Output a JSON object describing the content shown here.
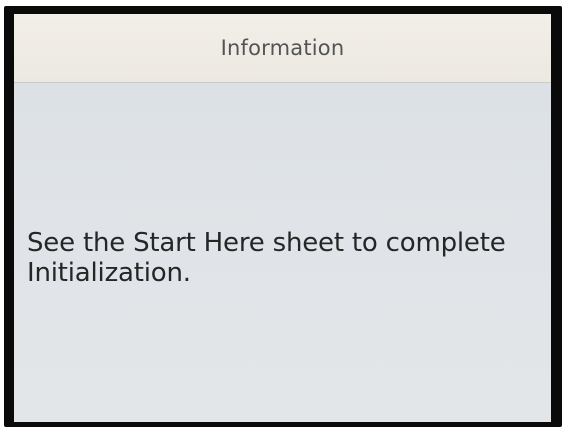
{
  "dialog": {
    "title": "Information",
    "message": "See the Start Here sheet to complete Initialization."
  }
}
